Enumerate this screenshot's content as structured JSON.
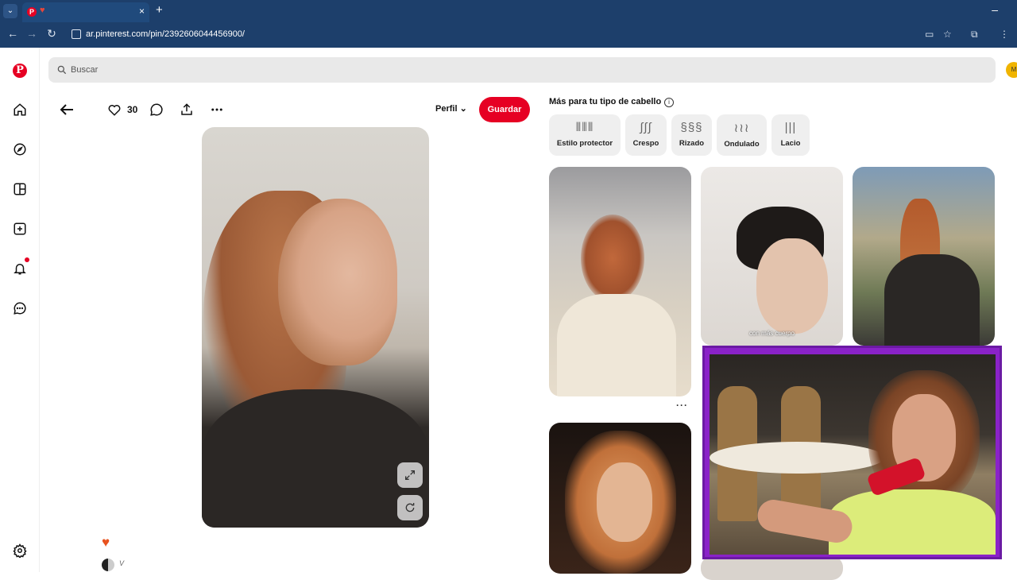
{
  "browser": {
    "url": "ar.pinterest.com/pin/2392606044456900/",
    "tab_close": "×",
    "new_tab": "+",
    "minimize": "–"
  },
  "header": {
    "search_placeholder": "Buscar",
    "avatar_initial": "M"
  },
  "pin": {
    "like_count": "30",
    "profile_label": "Perfil",
    "save_label": "Guardar",
    "creator_name": "V"
  },
  "related": {
    "title": "Más para tu tipo de cabello",
    "chips": [
      {
        "label": "Estilo protector",
        "glyph": "⦀⦀⦀"
      },
      {
        "label": "Crespo",
        "glyph": "∫∫∫"
      },
      {
        "label": "Rizado",
        "glyph": "§§§"
      },
      {
        "label": "Ondulado",
        "glyph": "≀≀≀"
      },
      {
        "label": "Lacio",
        "glyph": "|||"
      }
    ],
    "thumb_caption": "con más cuerpo",
    "more_label": "···"
  },
  "icons": {
    "rail": [
      "pinterest-logo",
      "home-icon",
      "explore-icon",
      "boards-icon",
      "create-icon",
      "notifications-icon",
      "messages-icon",
      "settings-icon"
    ],
    "brand_color": "#e60023"
  }
}
